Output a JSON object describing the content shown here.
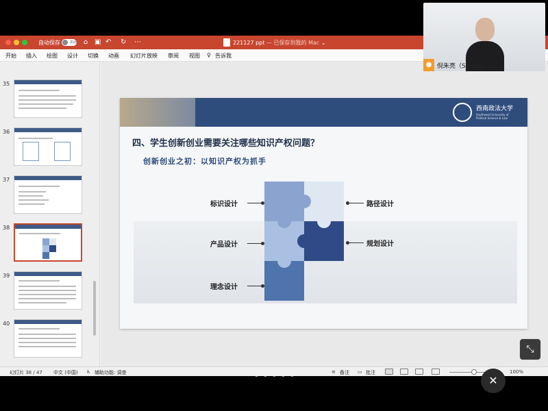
{
  "window": {
    "autosave_label": "自动保存",
    "autosave_state": "关闭",
    "doc_name": "221127 ppt",
    "doc_status": " — 已保存到我的 Mac",
    "chevron": "⌄"
  },
  "menu": [
    "开始",
    "插入",
    "绘图",
    "设计",
    "切换",
    "动画",
    "幻灯片放映",
    "审阅",
    "视图",
    "告诉我"
  ],
  "thumbnails": [
    {
      "num": "35"
    },
    {
      "num": "36"
    },
    {
      "num": "37"
    },
    {
      "num": "38"
    },
    {
      "num": "39"
    },
    {
      "num": "40"
    }
  ],
  "slide": {
    "logo_name": "西南政法大学",
    "logo_sub": "Southwest University of Political Science & Law",
    "title": "四、学生创新创业需要关注哪些知识产权问题？",
    "subtitle": "创新创业之初：以知识产权为抓手",
    "labels_left": [
      "标识设计",
      "产品设计",
      "理念设计"
    ],
    "labels_right": [
      "路径设计",
      "规划设计"
    ],
    "puzzle_colors": [
      "#8aa3cf",
      "#dfe7f3",
      "#a9c0e2",
      "#2f4a86",
      "#4f74ad"
    ]
  },
  "status": {
    "slide_counter": "幻灯片 38 / 47",
    "language": "中文 (中国)",
    "accessibility": "辅助功能: 调查",
    "notes": "备注",
    "comments": "批注",
    "zoom": "100%"
  },
  "video": {
    "participant": "倪朱亮（SeanNi）"
  }
}
